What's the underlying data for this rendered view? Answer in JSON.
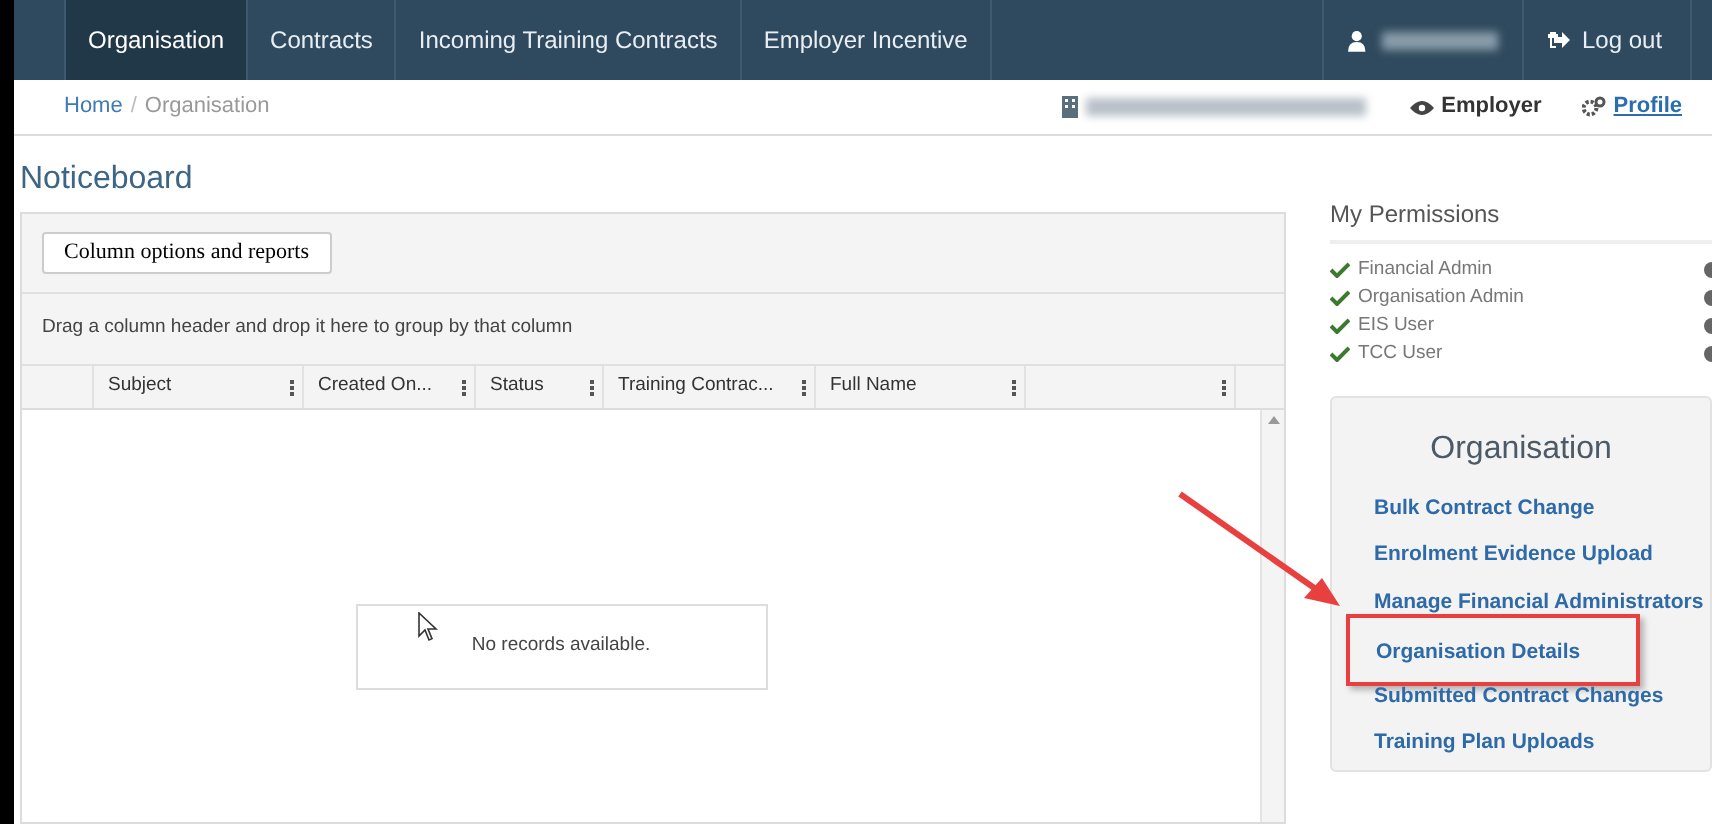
{
  "nav": {
    "items": [
      {
        "label": "Organisation",
        "selected": true
      },
      {
        "label": "Contracts",
        "selected": false
      },
      {
        "label": "Incoming Training Contracts",
        "selected": false
      },
      {
        "label": "Employer Incentive",
        "selected": false
      }
    ],
    "logout": "Log out"
  },
  "breadcrumb": [
    "Home",
    "Organisation"
  ],
  "breadcrumb_separator": "/",
  "context": {
    "role": "Employer",
    "profile": "Profile"
  },
  "noticeboard": {
    "title": "Noticeboard",
    "button": "Column options and reports",
    "group_hint": "Drag a column header and drop it here to group by that column",
    "columns": [
      {
        "label": "Subject"
      },
      {
        "label": "Created On..."
      },
      {
        "label": "Status"
      },
      {
        "label": "Training Contrac..."
      },
      {
        "label": "Full Name"
      },
      {}
    ],
    "empty_message": "No records available."
  },
  "permissions": {
    "title": "My Permissions",
    "items": [
      {
        "label": "Financial Admin",
        "granted": true
      },
      {
        "label": "Organisation Admin",
        "granted": true
      },
      {
        "label": "EIS User",
        "granted": true
      },
      {
        "label": "TCC User",
        "granted": true
      }
    ]
  },
  "organisation": {
    "title": "Organisation",
    "links": [
      {
        "label": "Bulk Contract Change",
        "highlighted": false
      },
      {
        "label": "Enrolment Evidence Upload",
        "highlighted": false
      },
      {
        "label": "Manage Financial Administrators",
        "highlighted": false
      },
      {
        "label": "Organisation Details",
        "highlighted": true
      },
      {
        "label": "Submitted Contract Changes",
        "highlighted": false
      },
      {
        "label": "Training Plan Uploads",
        "highlighted": false
      }
    ]
  }
}
